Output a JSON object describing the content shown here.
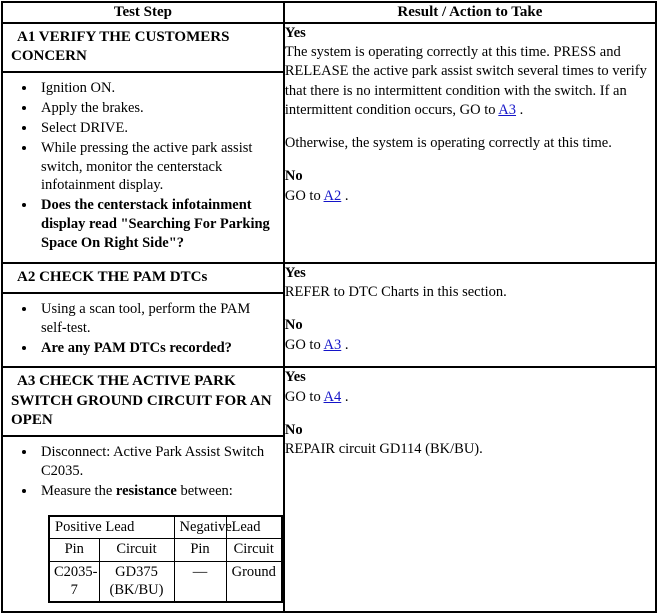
{
  "table": {
    "headers": {
      "test_step": "Test Step",
      "result": "Result / Action to Take"
    },
    "rows": [
      {
        "id": "A1",
        "title": "A1 VERIFY THE CUSTOMERS CONCERN",
        "steps": [
          "Ignition ON.",
          "Apply the brakes.",
          "Select DRIVE.",
          "While pressing the active park assist switch, monitor the centerstack infotainment display."
        ],
        "question": "Does the centerstack infotainment display read \"Searching For Parking Space On Right Side\"?",
        "result": {
          "yes_label": "Yes",
          "yes_text_before": "The system is operating correctly at this time. PRESS and RELEASE the active park assist switch several times to verify that there is no intermittent condition with the switch. If an intermittent condition occurs, GO to ",
          "yes_link": "A3",
          "yes_text_after": " .",
          "otherwise_text": "Otherwise, the system is operating correctly at this time.",
          "no_label": "No",
          "no_text_before": "GO to ",
          "no_link": "A2",
          "no_text_after": " ."
        }
      },
      {
        "id": "A2",
        "title": "A2 CHECK THE PAM DTCs",
        "steps": [
          "Using a scan tool, perform the PAM self-test."
        ],
        "question": "Are any PAM DTCs recorded?",
        "result": {
          "yes_label": "Yes",
          "yes_text": "REFER to DTC Charts in this section.",
          "no_label": "No",
          "no_text_before": "GO to ",
          "no_link": "A3",
          "no_text_after": " ."
        }
      },
      {
        "id": "A3",
        "title": "A3 CHECK THE ACTIVE PARK SWITCH GROUND CIRCUIT FOR AN OPEN",
        "steps": [
          "Disconnect: Active Park Assist Switch C2035."
        ],
        "measure_prefix": "Measure the ",
        "measure_bold": "resistance",
        "measure_suffix": " between:",
        "lead_table": {
          "group_positive": "Positive Lead",
          "group_negative": "Negative",
          "group_negative_2": "Lead",
          "subheaders": [
            "Pin",
            "Circuit",
            "Pin",
            "Circuit"
          ],
          "data_rows": [
            [
              "C2035-7",
              "GD375 (BK/BU)",
              "—",
              "Ground"
            ]
          ]
        },
        "result": {
          "yes_label": "Yes",
          "yes_text_before": "GO to ",
          "yes_link": "A4",
          "yes_text_after": " .",
          "no_label": "No",
          "no_text": "REPAIR circuit GD114 (BK/BU)."
        }
      }
    ]
  },
  "colors": {
    "link": "#1414c8",
    "border": "#000000",
    "text": "#000000",
    "background": "#ffffff"
  }
}
